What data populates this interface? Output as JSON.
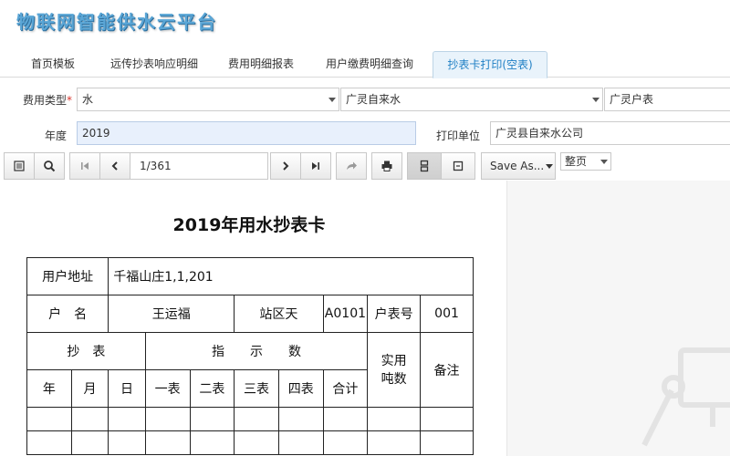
{
  "app": {
    "title": "物联网智能供水云平台"
  },
  "tabs": [
    {
      "label": "首页模板"
    },
    {
      "label": "远传抄表响应明细"
    },
    {
      "label": "费用明细报表"
    },
    {
      "label": "用户缴费明细查询"
    },
    {
      "label": "抄表卡打印(空表)"
    }
  ],
  "filters": {
    "fee_type_label": "费用类型",
    "required_mark": "*",
    "fee_type_value": "水",
    "company_value": "广灵自来水",
    "area_value": "广灵户表",
    "year_label": "年度",
    "year_value": "2019",
    "print_unit_label": "打印单位",
    "print_unit_value": "广灵县自来水公司"
  },
  "toolbar": {
    "page_value": "1/361",
    "save_as_label": "Save As...",
    "page_mode_value": "整页"
  },
  "report": {
    "title": "2019年用水抄表卡",
    "address_label": "用户地址",
    "address_value": "千福山庄1,1,201",
    "name_label": "户　名",
    "name_value": "王运福",
    "station_label": "站区天",
    "station_code": "A0101",
    "meter_no_label": "户表号",
    "meter_no_value": "001",
    "read_meter_header": "抄　表",
    "indication_header": "指　　示　　数",
    "actual_tons_header": "实用\n吨数",
    "remark_header": "备注",
    "sub_headers": {
      "year": "年",
      "month": "月",
      "day": "日",
      "meter1": "一表",
      "meter2": "二表",
      "meter3": "三表",
      "meter4": "四表",
      "total": "合计"
    }
  }
}
